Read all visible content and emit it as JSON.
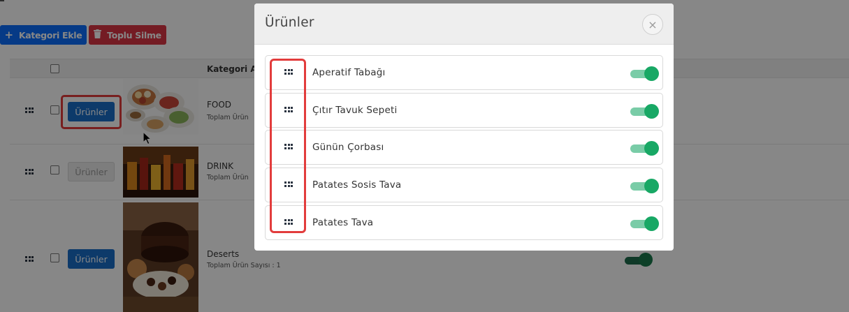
{
  "toolbar": {
    "add_label": "Kategori Ekle",
    "add_icon": "plus-icon",
    "delete_label": "Toplu Silme",
    "delete_icon": "trash-icon"
  },
  "table": {
    "column_name": "Kategori Ad",
    "rows": [
      {
        "title": "FOOD",
        "subtitle": "Toplam Ürün",
        "button": "Ürünler",
        "button_state": "active",
        "thumb": "food-thumbnail"
      },
      {
        "title": "DRINK",
        "subtitle": "Toplam Ürün",
        "button": "Ürünler",
        "button_state": "disabled",
        "thumb": "drink-thumbnail"
      },
      {
        "title": "Deserts",
        "subtitle": "Toplam Ürün Sayısı : 1",
        "button": "Ürünler",
        "button_state": "active",
        "thumb": "desserts-thumbnail"
      }
    ]
  },
  "modal": {
    "title": "Ürünler",
    "close": "×",
    "items": [
      {
        "label": "Aperatif Tabağı",
        "enabled": true
      },
      {
        "label": "Çıtır Tavuk Sepeti",
        "enabled": true
      },
      {
        "label": "Günün Çorbası",
        "enabled": true
      },
      {
        "label": "Patates Sosis Tava",
        "enabled": true
      },
      {
        "label": "Patates Tava",
        "enabled": true
      }
    ]
  },
  "colors": {
    "primary": "#0d6efd",
    "danger": "#dc3545",
    "toggle_on": "#18a865",
    "highlight": "#e23c3c"
  }
}
